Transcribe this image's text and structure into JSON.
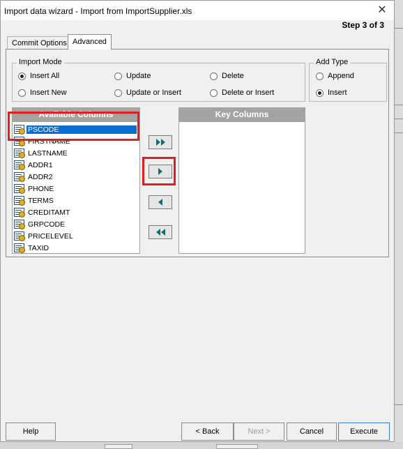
{
  "window": {
    "title": "Import data wizard - Import from ImportSupplier.xls",
    "step": "Step 3 of 3",
    "close_glyph": "✕"
  },
  "tabs": [
    {
      "label": "Commit Options",
      "active": false
    },
    {
      "label": "Advanced",
      "active": true
    }
  ],
  "import_mode": {
    "title": "Import Mode",
    "options": [
      {
        "label": "Insert All",
        "checked": true
      },
      {
        "label": "Update",
        "checked": false
      },
      {
        "label": "Delete",
        "checked": false
      },
      {
        "label": "Insert New",
        "checked": false
      },
      {
        "label": "Update or Insert",
        "checked": false
      },
      {
        "label": "Delete or Insert",
        "checked": false
      }
    ]
  },
  "add_type": {
    "title": "Add Type",
    "options": [
      {
        "label": "Append",
        "checked": false
      },
      {
        "label": "Insert",
        "checked": true
      }
    ]
  },
  "available_columns": {
    "header": "Available Columns",
    "items": [
      "PSCODE",
      "FIRSTNAME",
      "LASTNAME",
      "ADDR1",
      "ADDR2",
      "PHONE",
      "TERMS",
      "CREDITAMT",
      "GRPCODE",
      "PRICELEVEL",
      "TAXID"
    ],
    "selected": "PSCODE"
  },
  "key_columns": {
    "header": "Key Columns",
    "items": []
  },
  "move_buttons": {
    "add_all_icon": "double-right-arrow-icon",
    "add_icon": "right-arrow-icon",
    "remove_icon": "left-arrow-icon",
    "remove_all_icon": "double-left-arrow-icon"
  },
  "footer": {
    "help": "Help",
    "back": "< Back",
    "next": "Next >",
    "cancel": "Cancel",
    "execute": "Execute"
  },
  "colors": {
    "selection": "#0a6ed1",
    "list_header": "#a3a3a3",
    "annotation": "#e02020",
    "arrow": "#0f6d6d"
  }
}
